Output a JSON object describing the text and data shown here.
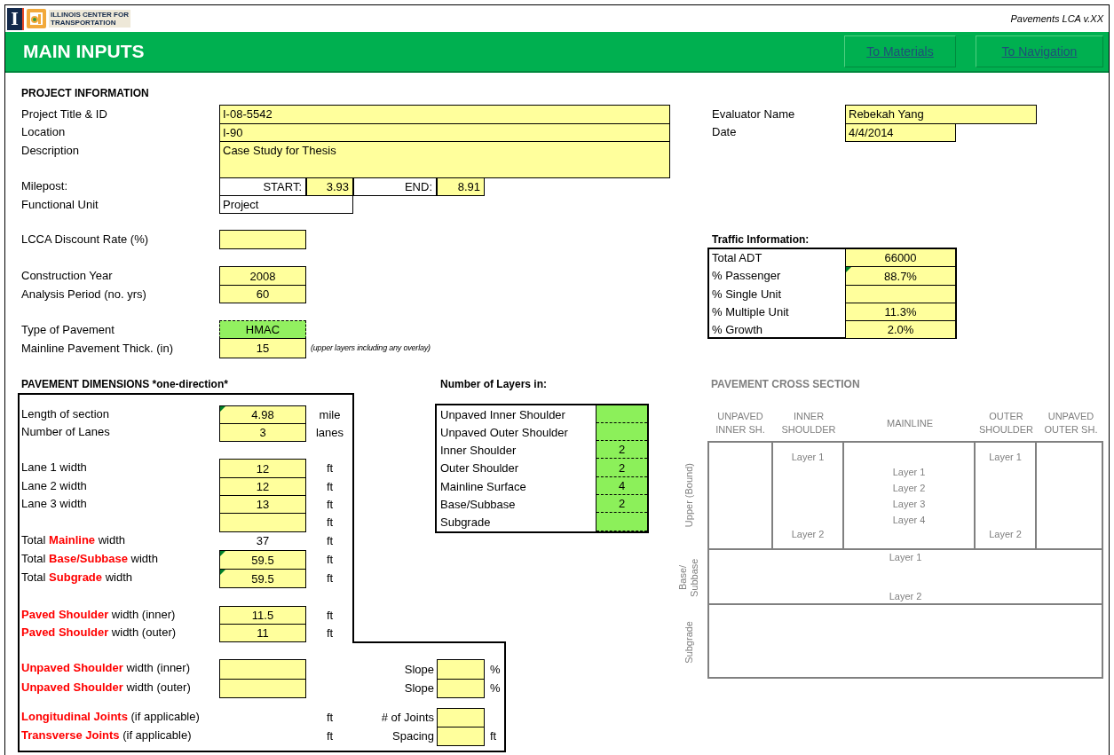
{
  "header": {
    "logo_mark": "I",
    "logo_lines": [
      "ILLINOIS CENTER FOR",
      "TRANSPORTATION"
    ],
    "version": "Pavements LCA v.XX"
  },
  "title_bar": {
    "title": "MAIN INPUTS",
    "buttons": [
      "To Materials",
      "To Navigation"
    ]
  },
  "project_information": {
    "heading": "PROJECT INFORMATION",
    "fields": [
      {
        "label": "Project Title & ID",
        "kind": "text",
        "value": "I-08-5542"
      },
      {
        "label": "Location",
        "kind": "text",
        "value": "I-90"
      },
      {
        "label": "Description",
        "kind": "text",
        "value": "Case Study for Thesis"
      },
      {
        "label": "Milepost:",
        "kind": "range",
        "start_label": "START:",
        "start": "3.93",
        "end_label": "END:",
        "end": "8.91"
      },
      {
        "label": "Functional Unit",
        "kind": "display",
        "value": "Project"
      },
      {
        "label": "LCCA Discount Rate (%)",
        "kind": "number"
      },
      {
        "label": "Construction Year",
        "kind": "number",
        "value": "2008"
      },
      {
        "label": "Analysis Period (no. yrs)",
        "kind": "number",
        "value": "60"
      },
      {
        "label": "Type of Pavement",
        "kind": "select",
        "value": "HMAC"
      },
      {
        "label": "Mainline Pavement Thick. (in)",
        "kind": "number",
        "value": "15",
        "note": "(upper layers including any overlay)"
      }
    ]
  },
  "evaluator": [
    {
      "label": "Evaluator Name",
      "value": "Rebekah Yang"
    },
    {
      "label": "Date",
      "value": "4/4/2014"
    }
  ],
  "traffic_information": {
    "heading": "Traffic Information:",
    "rows": [
      {
        "label": "Total ADT",
        "value": "66000",
        "flagged": false
      },
      {
        "label": "% Passenger",
        "value": "88.7%",
        "flagged": true
      },
      {
        "label": "% Single Unit",
        "flagged": false
      },
      {
        "label": "% Multiple Unit",
        "value": "11.3%",
        "flagged": false
      },
      {
        "label": "% Growth",
        "value": "2.0%",
        "flagged": false
      }
    ]
  },
  "pavement_dimensions": {
    "heading": "PAVEMENT DIMENSIONS *one-direction*",
    "rows": [
      {
        "label": "Length of section",
        "kind": "input",
        "value": "4.98",
        "unit": "mile",
        "flagged": true
      },
      {
        "label": "Number of Lanes",
        "kind": "input",
        "value": "3",
        "unit": "lanes",
        "flagged": false
      },
      {
        "label": "Lane 1 width",
        "kind": "input",
        "value": "12",
        "unit": "ft",
        "flagged": false
      },
      {
        "label": "Lane 2 width",
        "kind": "input",
        "value": "12",
        "unit": "ft",
        "flagged": false
      },
      {
        "label": "Lane 3 width",
        "kind": "input",
        "value": "13",
        "unit": "ft",
        "flagged": false
      },
      {
        "kind": "input",
        "unit": "ft",
        "flagged": false
      },
      {
        "label": "Total **Mainline** width",
        "kind": "computed",
        "value": "37",
        "unit": "ft",
        "flagged": false
      },
      {
        "label": "Total **Base/Subbase** width",
        "kind": "input",
        "value": "59.5",
        "unit": "ft",
        "flagged": true
      },
      {
        "label": "Total **Subgrade** width",
        "kind": "input",
        "value": "59.5",
        "unit": "ft",
        "flagged": true
      },
      {
        "label": "**Paved Shoulder** width (inner)",
        "kind": "input",
        "value": "11.5",
        "unit": "ft",
        "flagged": false
      },
      {
        "label": "**Paved Shoulder** width (outer)",
        "kind": "input",
        "value": "11",
        "unit": "ft",
        "flagged": false
      },
      {
        "label": "**Unpaved Shoulder** width (inner)",
        "kind": "input",
        "flagged": false,
        "side": {
          "label": "Slope",
          "unit": "%"
        }
      },
      {
        "label": "**Unpaved Shoulder** width (outer)",
        "kind": "input",
        "flagged": false,
        "side": {
          "label": "Slope",
          "unit": "%"
        }
      },
      {
        "label": "**Longitudinal Joints** (if applicable)",
        "kind": "none",
        "unit": "ft",
        "side": {
          "label": "# of Joints"
        }
      },
      {
        "label": "**Transverse Joints** (if applicable)",
        "kind": "none",
        "unit": "ft",
        "side": {
          "label": "Spacing",
          "unit": "ft"
        }
      }
    ]
  },
  "number_of_layers": {
    "heading": "Number of Layers in:",
    "rows": [
      {
        "label": "Unpaved Inner Shoulder"
      },
      {
        "label": "Unpaved Outer Shoulder"
      },
      {
        "label": "Inner Shoulder",
        "value": "2"
      },
      {
        "label": "Outer Shoulder",
        "value": "2"
      },
      {
        "label": "Mainline Surface",
        "value": "4"
      },
      {
        "label": "Base/Subbase",
        "value": "2"
      },
      {
        "label": "Subgrade"
      }
    ]
  },
  "cross_section": {
    "title": "PAVEMENT CROSS SECTION",
    "columns": [
      {
        "heading": "UNPAVED INNER SH."
      },
      {
        "heading": "INNER SHOULDER",
        "layers": [
          "Layer 1",
          "Layer 2"
        ]
      },
      {
        "heading": "MAINLINE",
        "layers": [
          "Layer 1",
          "Layer 2",
          "Layer 3",
          "Layer 4"
        ]
      },
      {
        "heading": "OUTER SHOULDER",
        "layers": [
          "Layer 1",
          "Layer 2"
        ]
      },
      {
        "heading": "UNPAVED OUTER SH."
      }
    ],
    "upper_label": "Upper (Bound)",
    "base": {
      "label": "Base/ Subbase",
      "layers": [
        "Layer 1",
        "Layer 2"
      ]
    },
    "subgrade": {
      "label": "Subgrade"
    }
  }
}
